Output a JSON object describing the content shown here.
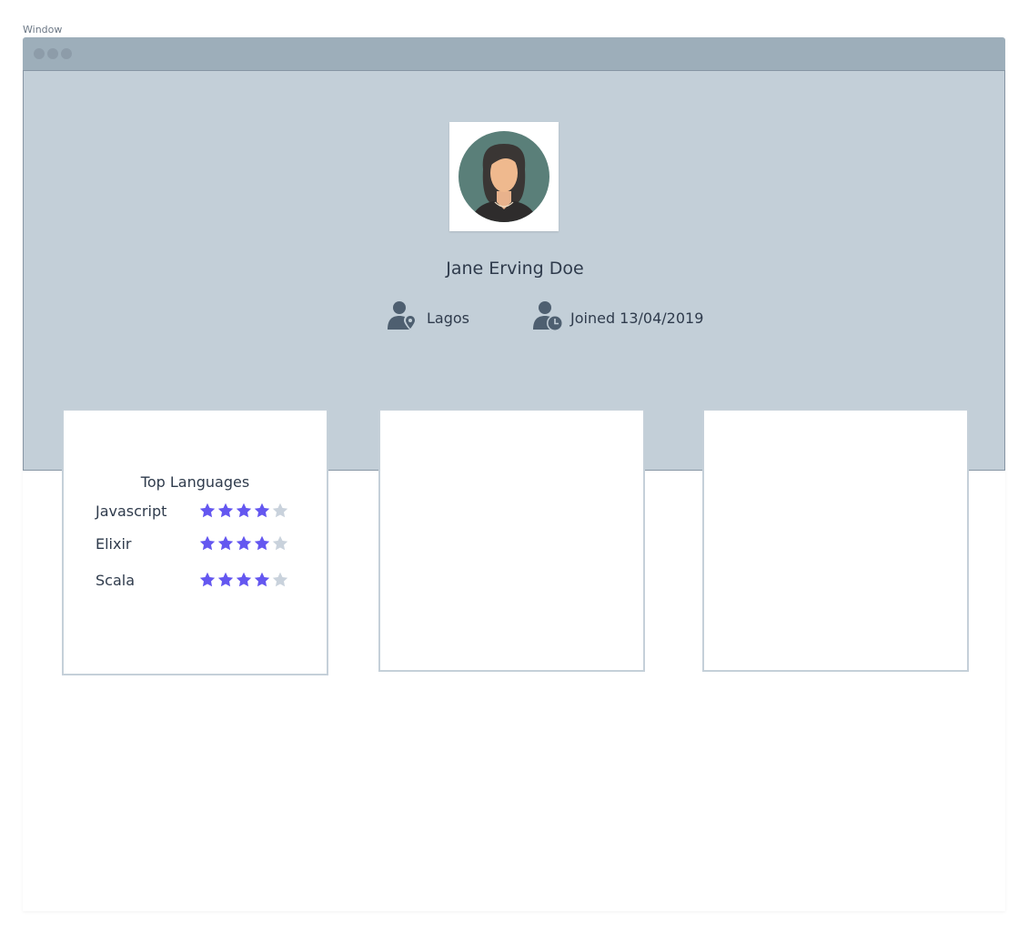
{
  "window": {
    "label": "Window"
  },
  "profile": {
    "name": "Jane Erving Doe",
    "location": "Lagos",
    "joined": "Joined 13/04/2019",
    "avatar_icon": "woman-avatar-icon"
  },
  "cards": {
    "languages": {
      "title": "Top Languages",
      "items": [
        {
          "name": "Javascript",
          "rating": 4,
          "max": 5
        },
        {
          "name": "Elixir",
          "rating": 4,
          "max": 5
        },
        {
          "name": "Scala",
          "rating": 4,
          "max": 5
        }
      ]
    }
  },
  "colors": {
    "hero_bg": "#c3cfd8",
    "titlebar": "#9daeba",
    "star_filled": "#6457f0",
    "star_empty": "#c9d2dc",
    "icon": "#4e5f70"
  }
}
